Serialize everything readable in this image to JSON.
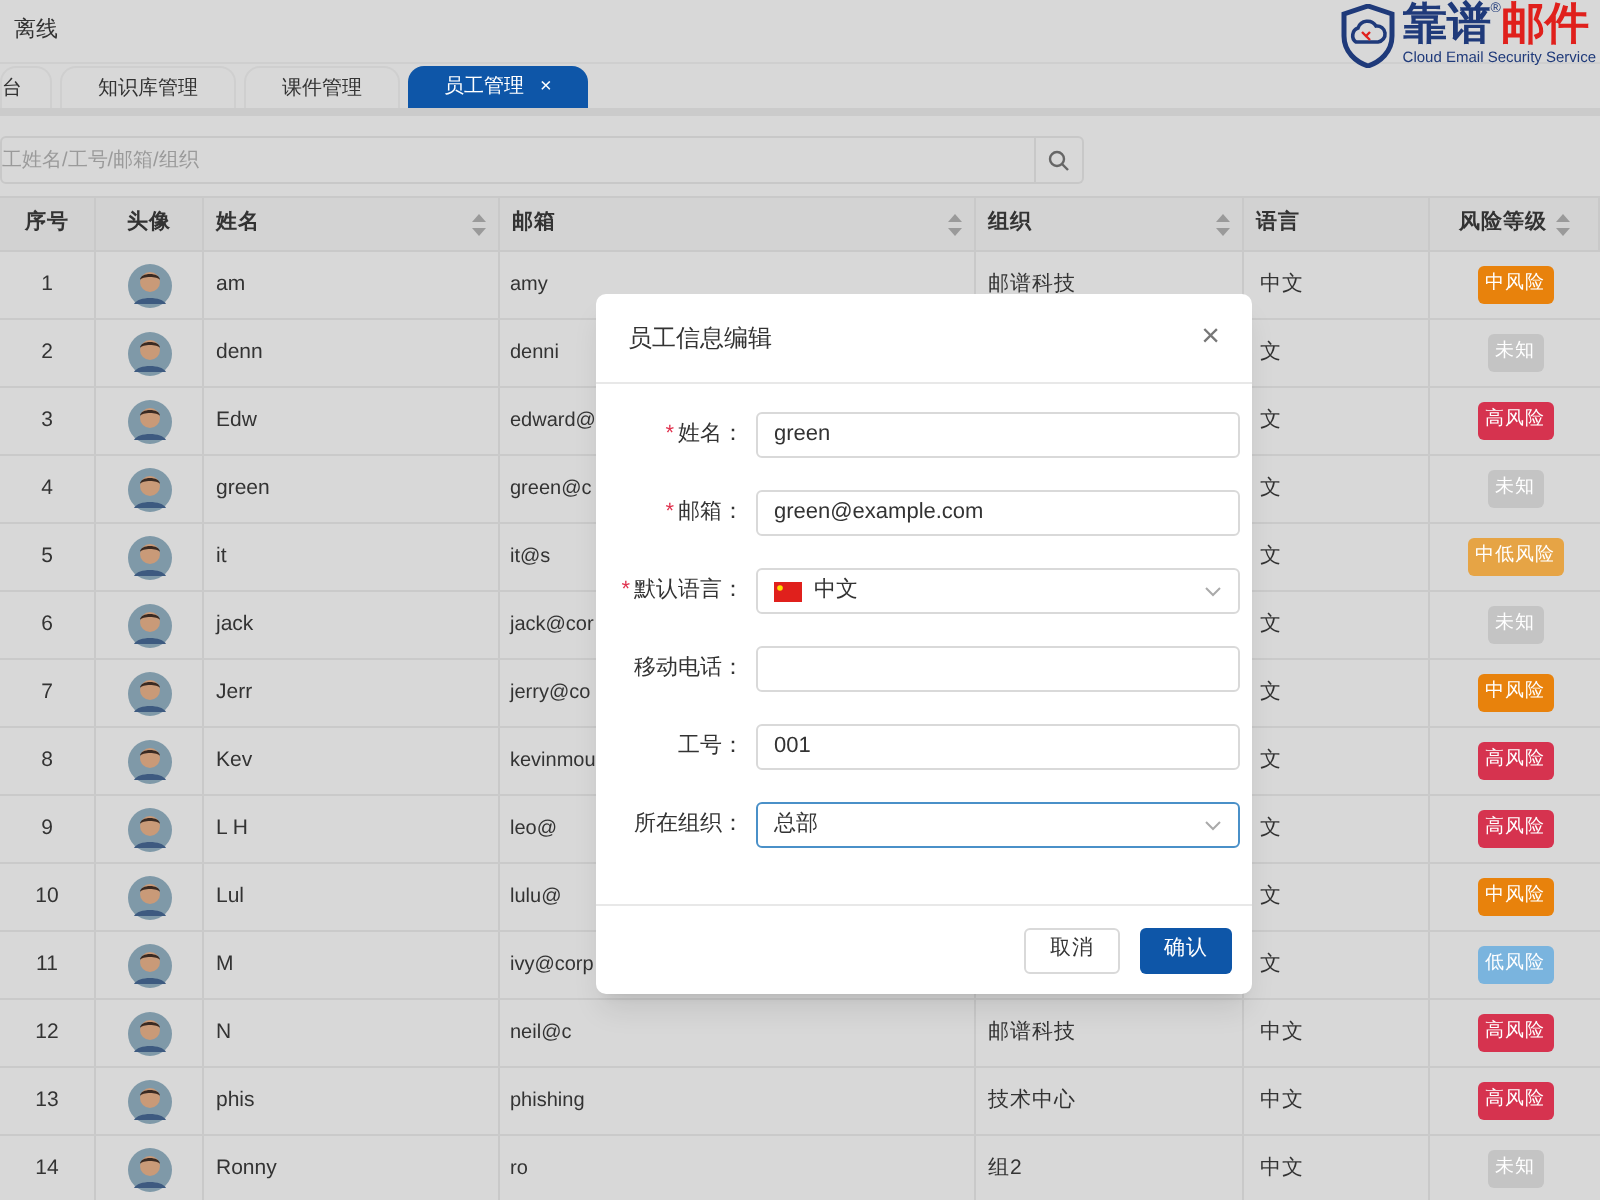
{
  "header": {
    "status": "离线",
    "logo": {
      "brand": "靠谱",
      "registered": "®",
      "product": "邮件",
      "tagline": "Cloud Email Security Service"
    }
  },
  "tabs": [
    {
      "label": "台",
      "selected": false
    },
    {
      "label": "知识库管理",
      "selected": false
    },
    {
      "label": "课件管理",
      "selected": false
    },
    {
      "label": "员工管理",
      "selected": true,
      "close": "×"
    }
  ],
  "search": {
    "placeholder": "工姓名/工号/邮箱/组织"
  },
  "table": {
    "columns": [
      {
        "label": "序号",
        "sortable": false
      },
      {
        "label": "头像",
        "sortable": false
      },
      {
        "label": "姓名",
        "sortable": true
      },
      {
        "label": "邮箱",
        "sortable": true
      },
      {
        "label": "组织",
        "sortable": true
      },
      {
        "label": "语言",
        "sortable": false
      },
      {
        "label": "风险等级",
        "sortable": true
      }
    ],
    "rows": [
      {
        "no": "1",
        "name": "am",
        "email": "amy",
        "org": "邮谱科技",
        "language": "中文",
        "risk": {
          "label": "中风险",
          "color": "#e8820c"
        }
      },
      {
        "no": "2",
        "name": "denn",
        "email": "denni",
        "language": "文",
        "risk": {
          "label": "未知",
          "color": "#c4c4c4"
        }
      },
      {
        "no": "3",
        "name": "Edw",
        "email": "edward@",
        "language": "文",
        "risk": {
          "label": "高风险",
          "color": "#d6334f"
        }
      },
      {
        "no": "4",
        "name": "green",
        "email": "green@c",
        "language": "文",
        "risk": {
          "label": "未知",
          "color": "#c4c4c4"
        }
      },
      {
        "no": "5",
        "name": "it",
        "email": "it@s",
        "language": "文",
        "risk": {
          "label": "中低风险",
          "color": "#e6a445"
        }
      },
      {
        "no": "6",
        "name": "jack",
        "email": "jack@cor",
        "language": "文",
        "risk": {
          "label": "未知",
          "color": "#c4c4c4"
        }
      },
      {
        "no": "7",
        "name": "Jerr",
        "email": "jerry@co",
        "language": "文",
        "risk": {
          "label": "中风险",
          "color": "#e8820c"
        }
      },
      {
        "no": "8",
        "name": "Kev",
        "email": "kevinmou",
        "language": "文",
        "risk": {
          "label": "高风险",
          "color": "#d6334f"
        }
      },
      {
        "no": "9",
        "name": "L H",
        "email": "leo@",
        "language": "文",
        "risk": {
          "label": "高风险",
          "color": "#d6334f"
        }
      },
      {
        "no": "10",
        "name": "Lul",
        "email": "lulu@",
        "language": "文",
        "risk": {
          "label": "中风险",
          "color": "#e8820c"
        }
      },
      {
        "no": "11",
        "name": "M",
        "email": "ivy@corp",
        "language": "文",
        "risk": {
          "label": "低风险",
          "color": "#7ab4de"
        }
      },
      {
        "no": "12",
        "name": "N",
        "email": "neil@c",
        "org": "邮谱科技",
        "language": "中文",
        "risk": {
          "label": "高风险",
          "color": "#d6334f"
        }
      },
      {
        "no": "13",
        "name": "phis",
        "email": "phishing",
        "org": "技术中心",
        "language": "中文",
        "risk": {
          "label": "高风险",
          "color": "#d6334f"
        }
      },
      {
        "no": "14",
        "name": "Ronny",
        "email": "ro",
        "org": "组2",
        "language": "中文",
        "risk": {
          "label": "未知",
          "color": "#c4c4c4"
        }
      }
    ]
  },
  "dialog": {
    "title": "员工信息编辑",
    "close": "×",
    "fields": [
      {
        "label": "姓名：",
        "required_mark": "*",
        "kind": "input",
        "value": "green",
        "focused": false
      },
      {
        "label": "邮箱：",
        "required_mark": "*",
        "kind": "input",
        "value": "green@example.com",
        "focused": false
      },
      {
        "label": "默认语言：",
        "required_mark": "*",
        "kind": "flag-select",
        "value": "中文",
        "focused": false
      },
      {
        "label": "移动电话：",
        "kind": "input",
        "focused": false
      },
      {
        "label": "工号：",
        "kind": "input",
        "value": "001",
        "focused": false
      },
      {
        "label": "所在组织：",
        "kind": "select",
        "value": "总部",
        "focused": true
      }
    ],
    "buttons": [
      {
        "label": "取消",
        "kind": "secondary"
      },
      {
        "label": "确认",
        "kind": "primary"
      }
    ]
  }
}
